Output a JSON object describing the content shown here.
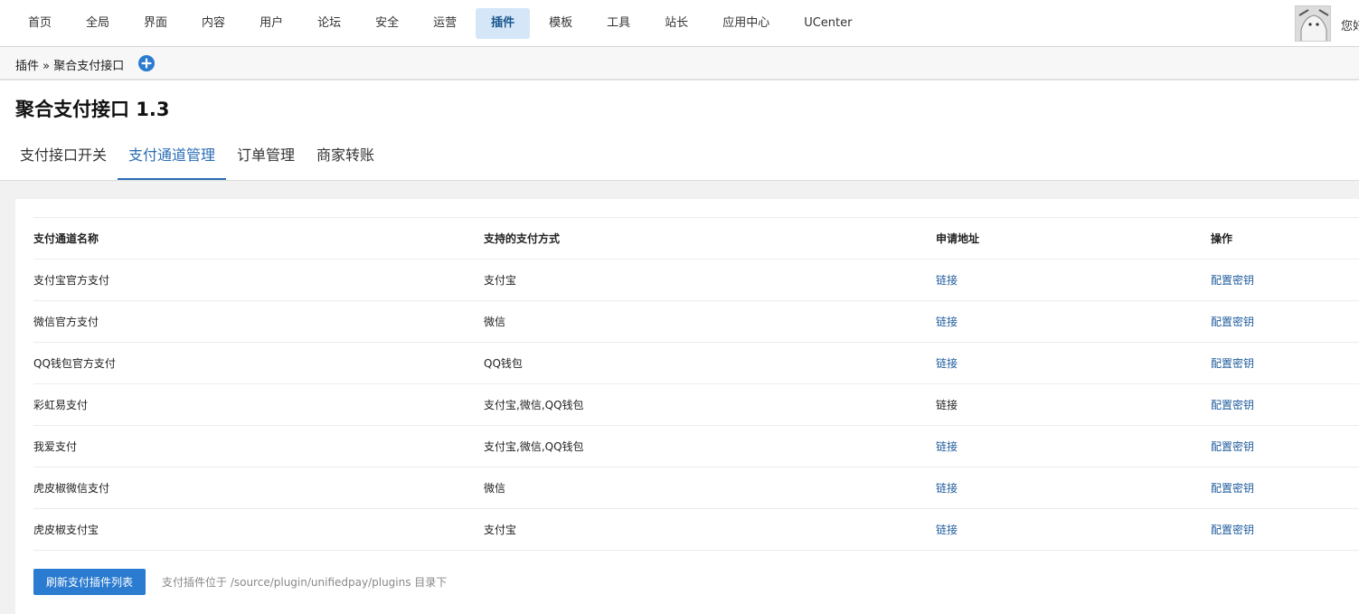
{
  "nav": {
    "items": [
      "首页",
      "全局",
      "界面",
      "内容",
      "用户",
      "论坛",
      "安全",
      "运营",
      "插件",
      "模板",
      "工具",
      "站长",
      "应用中心",
      "UCenter"
    ],
    "active_index": 8,
    "greeting": "您好"
  },
  "breadcrumb": {
    "text": "插件 » 聚合支付接口"
  },
  "plugin": {
    "title": "聚合支付接口 1.3"
  },
  "tabs": {
    "items": [
      "支付接口开关",
      "支付通道管理",
      "订单管理",
      "商家转账"
    ],
    "active_index": 1
  },
  "table": {
    "headers": [
      "支付通道名称",
      "支持的支付方式",
      "申请地址",
      "操作"
    ],
    "rows": [
      {
        "name": "支付宝官方支付",
        "methods": "支付宝",
        "apply": "链接",
        "apply_is_link": true,
        "action": "配置密钥"
      },
      {
        "name": "微信官方支付",
        "methods": "微信",
        "apply": "链接",
        "apply_is_link": true,
        "action": "配置密钥"
      },
      {
        "name": "QQ钱包官方支付",
        "methods": "QQ钱包",
        "apply": "链接",
        "apply_is_link": true,
        "action": "配置密钥"
      },
      {
        "name": "彩虹易支付",
        "methods": "支付宝,微信,QQ钱包",
        "apply": "链接",
        "apply_is_link": false,
        "action": "配置密钥"
      },
      {
        "name": "我爱支付",
        "methods": "支付宝,微信,QQ钱包",
        "apply": "链接",
        "apply_is_link": true,
        "action": "配置密钥"
      },
      {
        "name": "虎皮椒微信支付",
        "methods": "微信",
        "apply": "链接",
        "apply_is_link": true,
        "action": "配置密钥"
      },
      {
        "name": "虎皮椒支付宝",
        "methods": "支付宝",
        "apply": "链接",
        "apply_is_link": true,
        "action": "配置密钥"
      }
    ]
  },
  "footer": {
    "refresh_label": "刷新支付插件列表",
    "hint": "支付插件位于 /source/plugin/unifiedpay/plugins 目录下"
  },
  "colors": {
    "accent": "#2b7bd0",
    "link": "#1e5b9c",
    "active_nav_bg": "#d4e6f7"
  }
}
